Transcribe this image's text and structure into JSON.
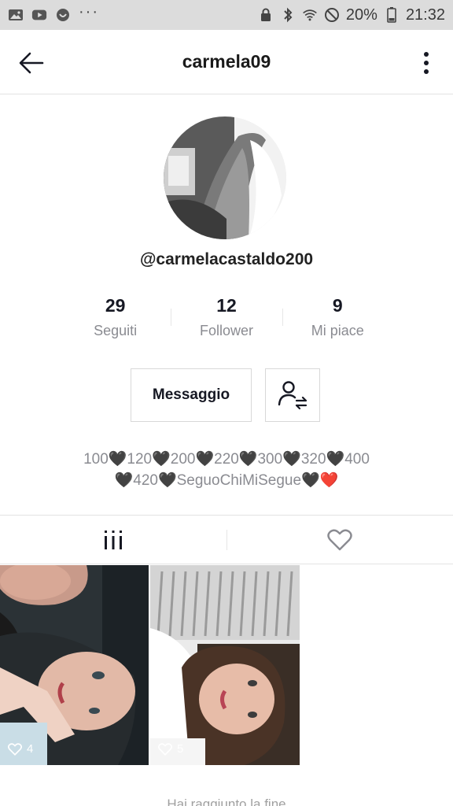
{
  "status_bar": {
    "battery": "20%",
    "time": "21:32",
    "overflow": "···"
  },
  "header": {
    "title": "carmela09"
  },
  "profile": {
    "username": "@carmelacastaldo200",
    "stats": [
      {
        "value": "29",
        "label": "Seguiti"
      },
      {
        "value": "12",
        "label": "Follower"
      },
      {
        "value": "9",
        "label": "Mi piace"
      }
    ],
    "message_button": "Messaggio",
    "bio_line1": "100🖤120🖤200🖤220🖤300🖤320🖤400",
    "bio_line2": "🖤420🖤SeguoChiMiSegue🖤❤️"
  },
  "videos": [
    {
      "likes": "4"
    },
    {
      "likes": "5"
    }
  ],
  "footer": {
    "end_text": "Hai raggiunto la fine"
  },
  "icons": {
    "back": "arrow-left",
    "more": "more-vertical",
    "follow_suggest": "person-swap",
    "grid_tab": "grid",
    "liked_tab": "heart-outline"
  },
  "colors": {
    "primary_text": "#161823",
    "secondary_text": "#8a8b91",
    "divider": "#e3e3e3",
    "status_bar_bg": "#dcdcdc"
  }
}
